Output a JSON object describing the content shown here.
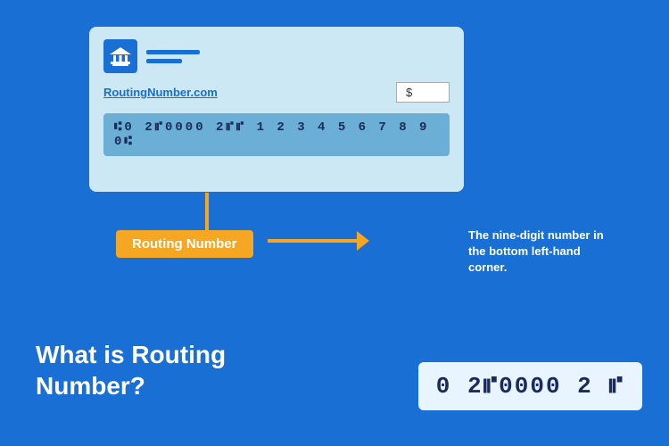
{
  "page": {
    "background_color": "#1a6fd4"
  },
  "check": {
    "website": "RoutingNumber.com",
    "dollar_label": "$",
    "micr_line": "⑆0 2⑈0000 2⑈⑈ 1 2 3 4 5 6 7 8 9 0⑆",
    "micr_display": "⑆0 2⑈0000 2 1⑈⑈ 1 2 3 4 5 6 7 8 9 0⑆"
  },
  "routing_badge": {
    "label": "Routing Number"
  },
  "description": {
    "text": "The nine-digit number in the bottom left-hand corner."
  },
  "heading": {
    "line1": "What is Routing",
    "line2": "Number?"
  },
  "routing_number_display": {
    "value": "0 2⑈0000 2 ⑈"
  }
}
